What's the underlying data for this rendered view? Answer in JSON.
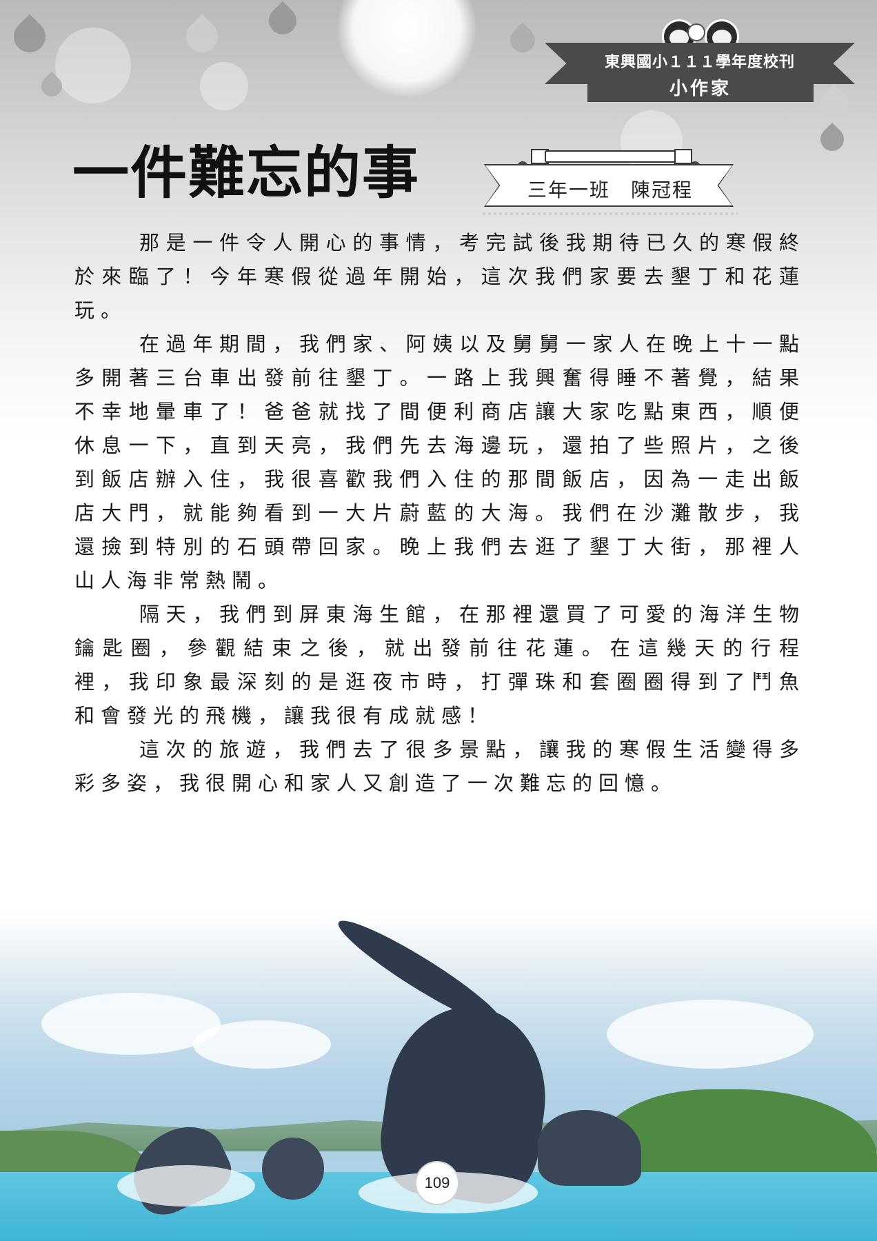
{
  "masthead": {
    "title": "東興國小１１１學年度校刊",
    "subtitle": "小作家"
  },
  "article": {
    "title": "一件難忘的事",
    "author": "三年一班　陳冠程",
    "paragraphs": [
      "那是一件令人開心的事情，考完試後我期待已久的寒假終於來臨了！今年寒假從過年開始，這次我們家要去墾丁和花蓮玩。",
      "在過年期間，我們家、阿姨以及舅舅一家人在晚上十一點多開著三台車出發前往墾丁。一路上我興奮得睡不著覺，結果不幸地暈車了！爸爸就找了間便利商店讓大家吃點東西，順便休息一下，直到天亮，我們先去海邊玩，還拍了些照片，之後到飯店辦入住，我很喜歡我們入住的那間飯店，因為一走出飯店大門，就能夠看到一大片蔚藍的大海。我們在沙灘散步，我還撿到特別的石頭帶回家。晚上我們去逛了墾丁大街，那裡人山人海非常熱鬧。",
      "隔天，我們到屏東海生館，在那裡還買了可愛的海洋生物鑰匙圈，參觀結束之後，就出發前往花蓮。在這幾天的行程裡，我印象最深刻的是逛夜市時，打彈珠和套圈圈得到了鬥魚和會發光的飛機，讓我很有成就感！",
      "這次的旅遊，我們去了很多景點，讓我的寒假生活變得多彩多姿，我很開心和家人又創造了一次難忘的回憶。"
    ]
  },
  "page": {
    "number": "109"
  },
  "colors": {
    "banner": "#4a4a4a",
    "text": "#1a1a1a",
    "pool": "#3fb4d6"
  }
}
